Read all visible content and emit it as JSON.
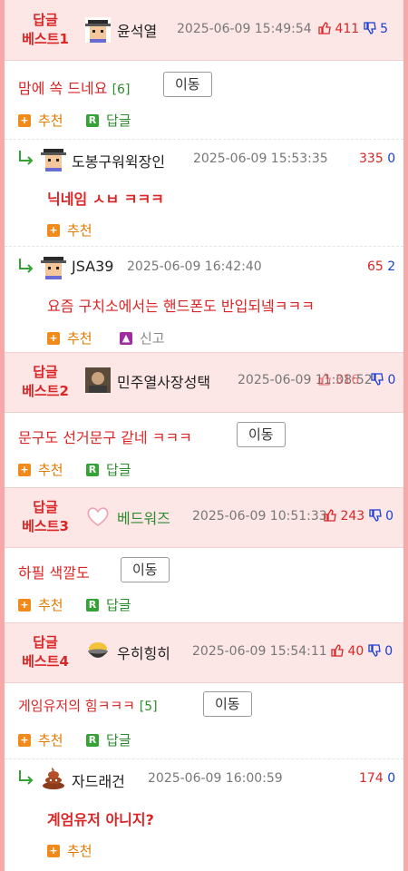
{
  "best": [
    {
      "label_line1": "답글",
      "label_line2": "베스트1",
      "nick": "윤석열",
      "date": "2025-06-09 15:49:54",
      "up": "411",
      "down": "5",
      "title": "맘에 쏙 드네요",
      "count": "[6]",
      "move_label": "이동",
      "recommend_label": "추천",
      "reply_label": "답글"
    },
    {
      "label_line1": "답글",
      "label_line2": "베스트2",
      "nick": "민주열사장성택",
      "date": "2025-06-09 11:08:52",
      "up": "316",
      "down": "0",
      "title": "문구도 선거문구 같네 ㅋㅋㅋ",
      "move_label": "이동",
      "recommend_label": "추천",
      "reply_label": "답글"
    },
    {
      "label_line1": "답글",
      "label_line2": "베스트3",
      "nick": "베드워즈",
      "date": "2025-06-09 10:51:33",
      "up": "243",
      "down": "0",
      "title": "하필 색깔도",
      "move_label": "이동",
      "recommend_label": "추천",
      "reply_label": "답글"
    },
    {
      "label_line1": "답글",
      "label_line2": "베스트4",
      "nick": "우히힝히",
      "date": "2025-06-09 15:54:11",
      "up": "40",
      "down": "0",
      "title": "게임유저의 힘ㅋㅋㅋ",
      "count": "[5]",
      "move_label": "이동",
      "recommend_label": "추천",
      "reply_label": "답글"
    }
  ],
  "replies": [
    {
      "nick": "도봉구워윅장인",
      "date": "2025-06-09 15:53:35",
      "up": "335",
      "down": "0",
      "text": "닉네임 ㅅㅂ ㅋㅋㅋ",
      "recommend_label": "추천"
    },
    {
      "nick": "JSA39",
      "date": "2025-06-09 16:42:40",
      "up": "65",
      "down": "2",
      "text": "요즘 구치소에서는 핸드폰도 반입되넼ㅋㅋㅋ",
      "recommend_label": "추천",
      "report_label": "신고"
    },
    {
      "nick": "자드래건",
      "date": "2025-06-09 16:00:59",
      "up": "174",
      "down": "0",
      "text": "계엄유저 아니지?",
      "recommend_label": "추천"
    }
  ],
  "colors": {
    "accent_red": "#d92626",
    "vote_down_blue": "#1a3fd1",
    "recommend_orange": "#f08a1a",
    "reply_green": "#35a235",
    "best_bg": "#fde6e6",
    "frame_pink": "#f7a8a8"
  },
  "icons": {
    "thumb_up": "thumbs-up-icon",
    "thumb_down": "thumbs-down-icon",
    "reply_arrow": "reply-arrow-icon",
    "recommend": "plus-icon",
    "reply": "r-icon",
    "report": "siren-icon"
  }
}
